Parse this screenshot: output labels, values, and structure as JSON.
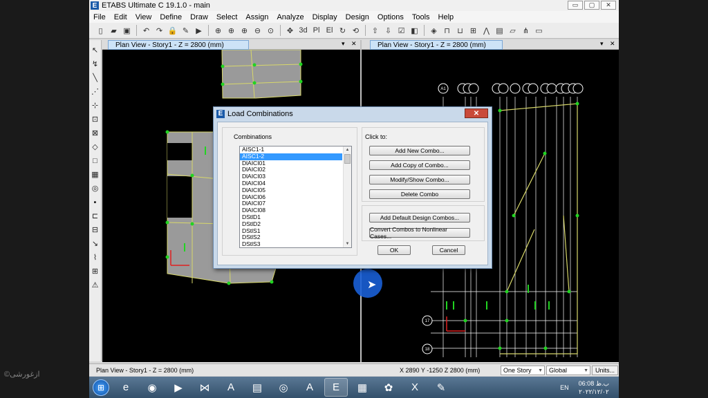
{
  "app": {
    "icon_letter": "E",
    "title": "ETABS Ultimate C 19.1.0 - main",
    "min": "▭",
    "max": "▢",
    "close": "✕"
  },
  "menu": [
    "File",
    "Edit",
    "View",
    "Define",
    "Draw",
    "Select",
    "Assign",
    "Analyze",
    "Display",
    "Design",
    "Options",
    "Tools",
    "Help"
  ],
  "toolbar_icons": [
    "new-icon",
    "open-icon",
    "save-icon",
    "undo-icon",
    "redo-icon",
    "lock-icon",
    "pen-icon",
    "run-icon",
    "zoom-window-icon",
    "zoom-rubber-icon",
    "zoom-in-icon",
    "zoom-out-icon",
    "zoom-fit-icon",
    "pan-icon",
    "view-3d-icon",
    "plan-view-icon",
    "elevation-view-icon",
    "rotate-icon",
    "perspective-icon",
    "move-up-icon",
    "move-down-icon",
    "check-icon",
    "object-icon",
    "shrink-icon",
    "frame-icon",
    "column-icon",
    "beam-icon",
    "brace-icon",
    "wall-icon",
    "slab-icon",
    "deck-icon",
    "area-icon"
  ],
  "left_tool_icons": [
    "pointer-icon",
    "reshape-icon",
    "line-icon",
    "snap-icon",
    "quick-draw-icon",
    "column-draw-icon",
    "brace-draw-icon",
    "area-draw-icon",
    "rect-area-icon",
    "wall-draw-icon",
    "opening-icon",
    "point-icon",
    "link-icon",
    "grid-icon",
    "dimension-icon",
    "spring-icon",
    "ruler-icon",
    "section-cut-icon"
  ],
  "left_pane": {
    "title": "Plan View - Story1 - Z = 2800 (mm)",
    "dropdown": "▾",
    "close": "✕"
  },
  "right_pane": {
    "title": "Plan View - Story1 - Z = 2800 (mm)",
    "dropdown": "▾",
    "close": "✕",
    "grid_bubbles_top": [
      "A1",
      "",
      "",
      "",
      "",
      "",
      "",
      "",
      "",
      "",
      "",
      "",
      "",
      "",
      ""
    ],
    "grid_bubbles_left": [
      "17",
      "18"
    ]
  },
  "dialog": {
    "icon_letter": "E",
    "title": "Load Combinations",
    "close": "✕",
    "combinations_label": "Combinations",
    "click_to_label": "Click to:",
    "combinations": [
      "AISC1-1",
      "AISC1-2",
      "DlAICI01",
      "DlAICI02",
      "DlAICI03",
      "DlAICI04",
      "DlAICI05",
      "DlAICI06",
      "DlAICI07",
      "DlAICI08",
      "DStlD1",
      "DStlD2",
      "DStlS1",
      "DStlS2",
      "DStlS3"
    ],
    "selected_index": 1,
    "scroll_up": "▲",
    "scroll_down": "▼",
    "buttons": {
      "add_new": "Add New Combo...",
      "add_copy": "Add Copy of Combo...",
      "modify_show": "Modify/Show Combo...",
      "delete": "Delete Combo",
      "add_default": "Add Default Design Combos...",
      "convert": "Convert Combos to Nonlinear Cases...",
      "ok": "OK",
      "cancel": "Cancel"
    }
  },
  "status": {
    "view": "Plan View - Story1 - Z = 2800 (mm)",
    "coords": "X 2890  Y -1250  Z 2800 (mm)",
    "story_select": "One Story",
    "coord_system": "Global",
    "units": "Units..."
  },
  "taskbar": {
    "start": "⊞",
    "apps": [
      "ie-icon",
      "firefox-icon",
      "media-player-icon",
      "visual-studio-icon",
      "pdf-icon",
      "file-explorer-icon",
      "chrome-icon",
      "autocad-icon",
      "etabs-icon",
      "calculator-icon",
      "paint-icon",
      "excel-icon",
      "sketch-icon"
    ],
    "active_app": "etabs-icon",
    "language": "EN",
    "time": "06:08 ب.ظ",
    "date": "۲۰۲۲/۱۲/۰۲"
  },
  "watermark": "©ازغورشی"
}
